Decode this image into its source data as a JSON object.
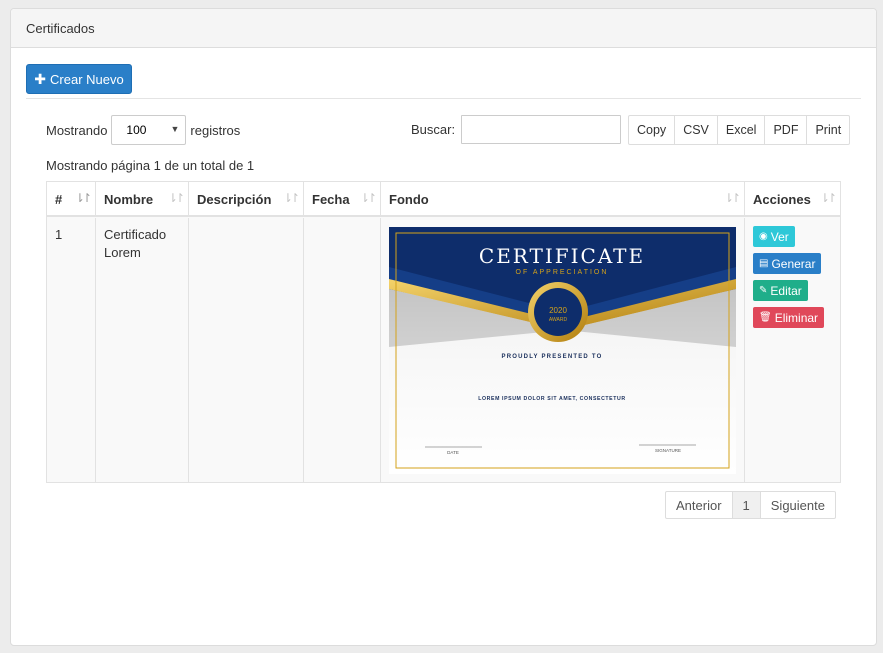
{
  "panel": {
    "title": "Certificados"
  },
  "toolbar": {
    "new_label": "Crear Nuevo",
    "new_icon": "plus-icon"
  },
  "length": {
    "prefix": "Mostrando",
    "value": "100",
    "suffix": "registros",
    "options": [
      "100"
    ]
  },
  "search": {
    "label": "Buscar:",
    "value": "",
    "placeholder": ""
  },
  "export": [
    "Copy",
    "CSV",
    "Excel",
    "PDF",
    "Print"
  ],
  "info": "Mostrando página 1 de un total de 1",
  "table": {
    "columns": [
      "#",
      "Nombre",
      "Descripción",
      "Fecha",
      "Fondo",
      "Acciones"
    ],
    "rows": [
      {
        "id": "1",
        "nombre": "Certificado Lorem",
        "descripcion": "",
        "fecha": ""
      }
    ]
  },
  "certificate": {
    "title": "CERTIFICATE",
    "subtitle": "OF APPRECIATION",
    "seal_year": "2020",
    "seal_text": "AWARD",
    "presented": "PROUDLY PRESENTED TO",
    "body": "LOREM IPSUM DOLOR SIT AMET, CONSECTETUR",
    "date_label": "DATE",
    "signature_label": "SIGNATURE",
    "colors": {
      "navy": "#0e2d6b",
      "gold": "#d4a21a"
    }
  },
  "actions": {
    "view": "Ver",
    "generate": "Generar",
    "edit": "Editar",
    "delete": "Eliminar",
    "colors": {
      "view": "#2ec8d8",
      "generate": "#2a7fc8",
      "edit": "#1fae8a",
      "delete": "#e0485a"
    }
  },
  "pagination": {
    "prev": "Anterior",
    "page": "1",
    "next": "Siguiente"
  }
}
